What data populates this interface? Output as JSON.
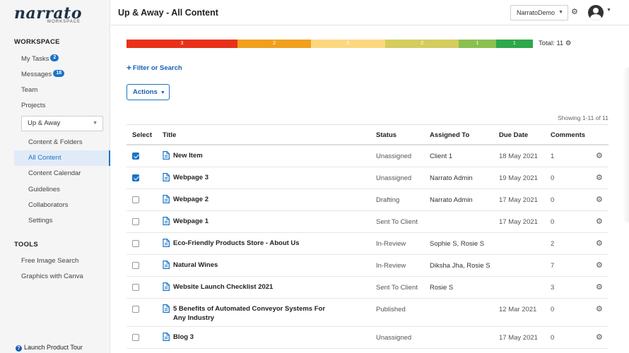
{
  "brand": {
    "name": "narrato",
    "sub": "WORKSPACE"
  },
  "sidebar": {
    "workspace_heading": "WORKSPACE",
    "my_tasks": {
      "label": "My Tasks",
      "badge": "2"
    },
    "messages": {
      "label": "Messages",
      "badge": "18"
    },
    "team": "Team",
    "projects": "Projects",
    "project_select": "Up & Away",
    "project_items": [
      "Content & Folders",
      "All Content",
      "Content Calendar",
      "Guidelines",
      "Collaborators",
      "Settings"
    ],
    "tools_heading": "TOOLS",
    "tools_items": [
      "Free Image Search",
      "Graphics with Canva"
    ],
    "launch_tour": "Launch Product Tour"
  },
  "header": {
    "title": "Up & Away - All Content",
    "account_select": "NarratoDemo"
  },
  "status_bar": {
    "segments": [
      {
        "count": "3",
        "color": "#e8311a",
        "share": 0.273
      },
      {
        "count": "2",
        "color": "#f0a01e",
        "share": 0.182
      },
      {
        "count": "2",
        "color": "#fcd77f",
        "share": 0.182
      },
      {
        "count": "2",
        "color": "#d4cc5e",
        "share": 0.182
      },
      {
        "count": "1",
        "color": "#8bc050",
        "share": 0.091
      },
      {
        "count": "1",
        "color": "#2ea84a",
        "share": 0.091
      }
    ],
    "total_label": "Total: 11"
  },
  "toolbar": {
    "filter_label": "Filter or Search",
    "actions_label": "Actions",
    "showing_label": "Showing 1-11 of 11"
  },
  "table": {
    "headers": {
      "select": "Select",
      "title": "Title",
      "status": "Status",
      "assigned": "Assigned To",
      "due": "Due Date",
      "comments": "Comments"
    },
    "rows": [
      {
        "checked": true,
        "title": "New Item",
        "title2": "",
        "status": "Unassigned",
        "assigned": "Client 1",
        "due": "18 May 2021",
        "comments": "1"
      },
      {
        "checked": true,
        "title": "Webpage 3",
        "title2": "",
        "status": "Unassigned",
        "assigned": "Narrato Admin",
        "due": "19 May 2021",
        "comments": "0"
      },
      {
        "checked": false,
        "title": "Webpage 2",
        "title2": "",
        "status": "Drafting",
        "assigned": "Narrato Admin",
        "due": "17 May 2021",
        "comments": "0"
      },
      {
        "checked": false,
        "title": "Webpage 1",
        "title2": "",
        "status": "Sent To Client",
        "assigned": "",
        "due": "17 May 2021",
        "comments": "0"
      },
      {
        "checked": false,
        "title": "Eco-Friendly Products Store - About Us",
        "title2": "",
        "status": "In-Review",
        "assigned": "Sophie S, Rosie S",
        "due": "",
        "comments": "2"
      },
      {
        "checked": false,
        "title": "Natural Wines",
        "title2": "",
        "status": "In-Review",
        "assigned": "Diksha Jha, Rosie S",
        "due": "",
        "comments": "7"
      },
      {
        "checked": false,
        "title": "Website Launch Checklist 2021",
        "title2": "",
        "status": "Sent To Client",
        "assigned": "Rosie S",
        "due": "",
        "comments": "3"
      },
      {
        "checked": false,
        "title": "5 Benefits of Automated Conveyor Systems For",
        "title2": "Any Industry",
        "status": "Published",
        "assigned": "",
        "due": "12 Mar 2021",
        "comments": "0"
      },
      {
        "checked": false,
        "title": "Blog 3",
        "title2": "",
        "status": "Unassigned",
        "assigned": "",
        "due": "17 May 2021",
        "comments": "0"
      }
    ]
  },
  "icons": {
    "gear": "gear-icon",
    "doc": "document-icon",
    "plus": "plus-icon",
    "help": "help-circle-icon",
    "avatar": "user-avatar-icon"
  },
  "colors": {
    "accent": "#1a73c8",
    "active_bg": "#e1ebf7"
  }
}
